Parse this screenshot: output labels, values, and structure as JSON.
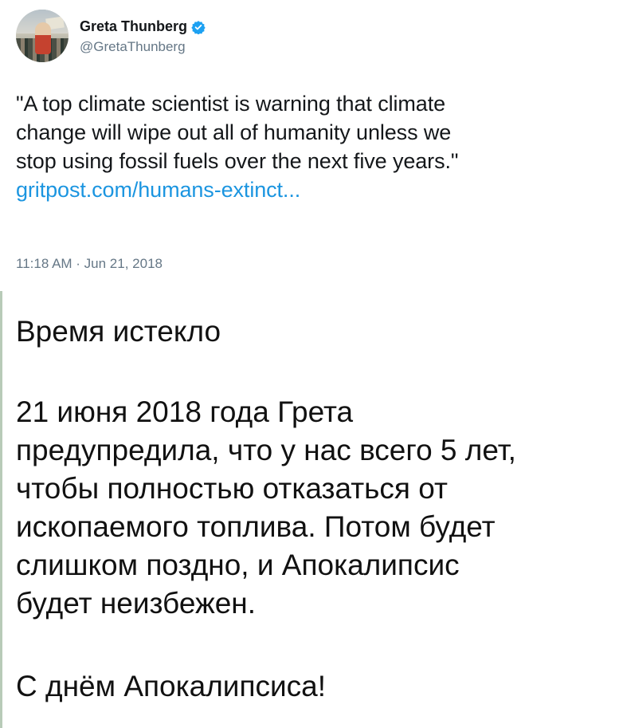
{
  "tweet": {
    "author": {
      "display_name": "Greta Thunberg",
      "handle": "@GretaThunberg",
      "verified": true,
      "verified_color": "#1da1f2"
    },
    "text_lines": [
      "\"A top climate scientist is warning that climate",
      "change will wipe out all of humanity unless we",
      "stop using fossil fuels over the next five years.\""
    ],
    "link_text": "gritpost.com/humans-extinct...",
    "link_color": "#1b95e0",
    "timestamp": "11:18 AM · Jun 21, 2018"
  },
  "caption": {
    "title": "Время истекло",
    "body_lines": [
      "21 июня 2018 года Грета",
      "предупредила, что у нас всего 5 лет,",
      "чтобы полностью отказаться от",
      "ископаемого топлива. Потом будет",
      "слишком поздно, и Апокалипсис",
      "будет неизбежен."
    ],
    "closing": "С днём Апокалипсиса!"
  }
}
